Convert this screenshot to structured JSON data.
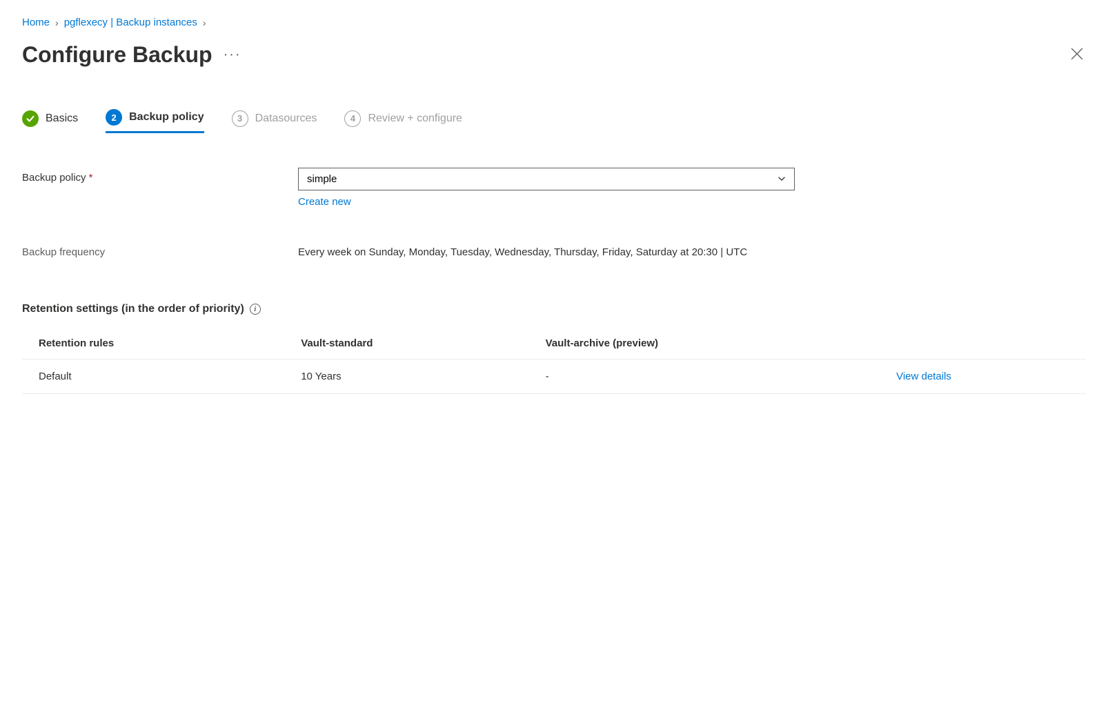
{
  "breadcrumb": {
    "items": [
      {
        "label": "Home"
      },
      {
        "label": "pgflexecy | Backup instances"
      }
    ]
  },
  "header": {
    "title": "Configure Backup"
  },
  "wizard": {
    "steps": [
      {
        "label": "Basics",
        "state": "done"
      },
      {
        "label": "Backup policy",
        "state": "current",
        "num": "2"
      },
      {
        "label": "Datasources",
        "state": "pending",
        "num": "3"
      },
      {
        "label": "Review + configure",
        "state": "pending",
        "num": "4"
      }
    ]
  },
  "form": {
    "backup_policy_label": "Backup policy",
    "backup_policy_value": "simple",
    "create_new_link": "Create new",
    "backup_frequency_label": "Backup frequency",
    "backup_frequency_value": "Every week on Sunday, Monday, Tuesday, Wednesday, Thursday, Friday, Saturday at 20:30 | UTC"
  },
  "retention": {
    "heading": "Retention settings (in the order of priority)",
    "columns": {
      "rules": "Retention rules",
      "standard": "Vault-standard",
      "archive": "Vault-archive (preview)"
    },
    "rows": [
      {
        "name": "Default",
        "standard": "10 Years",
        "archive": "-",
        "action": "View details"
      }
    ]
  }
}
